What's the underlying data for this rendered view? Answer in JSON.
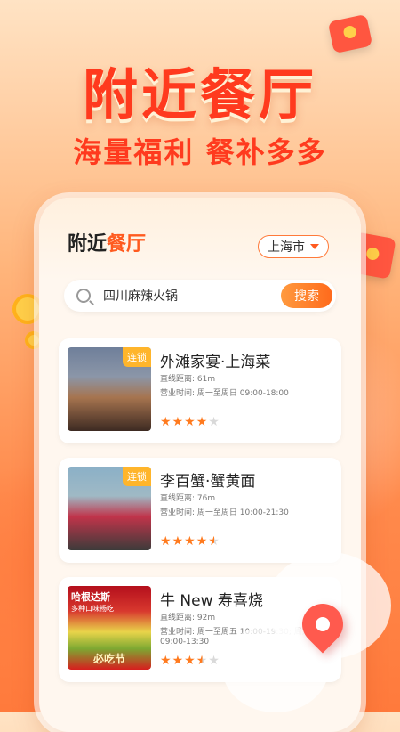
{
  "hero": {
    "title": "附近餐厅",
    "subtitle": "海量福利 餐补多多"
  },
  "app": {
    "title_part1": "附近",
    "title_part2": "餐厅",
    "city": "上海市"
  },
  "search": {
    "value": "四川麻辣火锅",
    "button": "搜索"
  },
  "restaurants": [
    {
      "badge": "连锁",
      "name": "外滩家宴·上海菜",
      "distance": "直线距离: 61m",
      "hours": "营业时间: 周一至周日 09:00-18:00",
      "hours2": "",
      "rating": 4
    },
    {
      "badge": "连锁",
      "name": "李百蟹·蟹黄面",
      "distance": "直线距离: 76m",
      "hours": "营业时间: 周一至周日 10:00-21:30",
      "hours2": "",
      "rating": 4.5
    },
    {
      "badge": "",
      "name": "牛 New 寿喜烧",
      "distance": "直线距离: 92m",
      "hours": "营业时间: 周一至周五 10:00-19:30; 周六",
      "hours2": "09:00-13:30",
      "rating": 3.5,
      "thumb_label": "哈根达斯",
      "thumb_sub": "多种口味畅吃",
      "thumb_tag": "必吃节"
    }
  ],
  "colors": {
    "accent": "#ff5a1f",
    "title_red": "#ff3a1e",
    "badge": "#ffb52b",
    "star": "#ff7a1e"
  }
}
